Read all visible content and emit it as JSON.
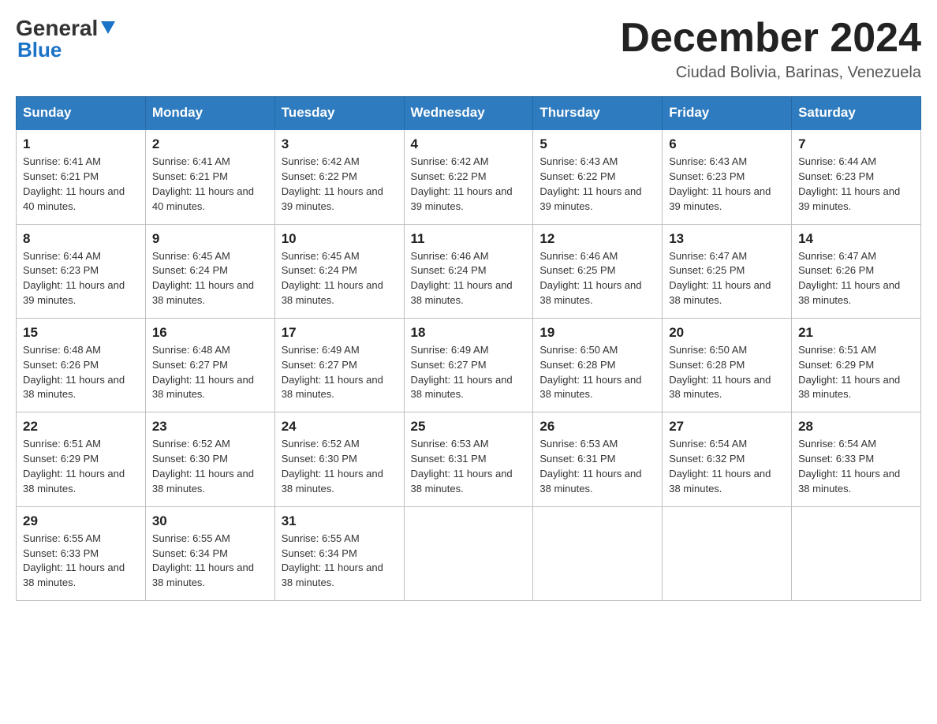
{
  "header": {
    "logo": {
      "general": "General",
      "blue": "Blue"
    },
    "title": "December 2024",
    "subtitle": "Ciudad Bolivia, Barinas, Venezuela"
  },
  "days_of_week": [
    "Sunday",
    "Monday",
    "Tuesday",
    "Wednesday",
    "Thursday",
    "Friday",
    "Saturday"
  ],
  "weeks": [
    {
      "days": [
        {
          "num": "1",
          "sunrise": "6:41 AM",
          "sunset": "6:21 PM",
          "daylight": "11 hours and 40 minutes."
        },
        {
          "num": "2",
          "sunrise": "6:41 AM",
          "sunset": "6:21 PM",
          "daylight": "11 hours and 40 minutes."
        },
        {
          "num": "3",
          "sunrise": "6:42 AM",
          "sunset": "6:22 PM",
          "daylight": "11 hours and 39 minutes."
        },
        {
          "num": "4",
          "sunrise": "6:42 AM",
          "sunset": "6:22 PM",
          "daylight": "11 hours and 39 minutes."
        },
        {
          "num": "5",
          "sunrise": "6:43 AM",
          "sunset": "6:22 PM",
          "daylight": "11 hours and 39 minutes."
        },
        {
          "num": "6",
          "sunrise": "6:43 AM",
          "sunset": "6:23 PM",
          "daylight": "11 hours and 39 minutes."
        },
        {
          "num": "7",
          "sunrise": "6:44 AM",
          "sunset": "6:23 PM",
          "daylight": "11 hours and 39 minutes."
        }
      ]
    },
    {
      "days": [
        {
          "num": "8",
          "sunrise": "6:44 AM",
          "sunset": "6:23 PM",
          "daylight": "11 hours and 39 minutes."
        },
        {
          "num": "9",
          "sunrise": "6:45 AM",
          "sunset": "6:24 PM",
          "daylight": "11 hours and 38 minutes."
        },
        {
          "num": "10",
          "sunrise": "6:45 AM",
          "sunset": "6:24 PM",
          "daylight": "11 hours and 38 minutes."
        },
        {
          "num": "11",
          "sunrise": "6:46 AM",
          "sunset": "6:24 PM",
          "daylight": "11 hours and 38 minutes."
        },
        {
          "num": "12",
          "sunrise": "6:46 AM",
          "sunset": "6:25 PM",
          "daylight": "11 hours and 38 minutes."
        },
        {
          "num": "13",
          "sunrise": "6:47 AM",
          "sunset": "6:25 PM",
          "daylight": "11 hours and 38 minutes."
        },
        {
          "num": "14",
          "sunrise": "6:47 AM",
          "sunset": "6:26 PM",
          "daylight": "11 hours and 38 minutes."
        }
      ]
    },
    {
      "days": [
        {
          "num": "15",
          "sunrise": "6:48 AM",
          "sunset": "6:26 PM",
          "daylight": "11 hours and 38 minutes."
        },
        {
          "num": "16",
          "sunrise": "6:48 AM",
          "sunset": "6:27 PM",
          "daylight": "11 hours and 38 minutes."
        },
        {
          "num": "17",
          "sunrise": "6:49 AM",
          "sunset": "6:27 PM",
          "daylight": "11 hours and 38 minutes."
        },
        {
          "num": "18",
          "sunrise": "6:49 AM",
          "sunset": "6:27 PM",
          "daylight": "11 hours and 38 minutes."
        },
        {
          "num": "19",
          "sunrise": "6:50 AM",
          "sunset": "6:28 PM",
          "daylight": "11 hours and 38 minutes."
        },
        {
          "num": "20",
          "sunrise": "6:50 AM",
          "sunset": "6:28 PM",
          "daylight": "11 hours and 38 minutes."
        },
        {
          "num": "21",
          "sunrise": "6:51 AM",
          "sunset": "6:29 PM",
          "daylight": "11 hours and 38 minutes."
        }
      ]
    },
    {
      "days": [
        {
          "num": "22",
          "sunrise": "6:51 AM",
          "sunset": "6:29 PM",
          "daylight": "11 hours and 38 minutes."
        },
        {
          "num": "23",
          "sunrise": "6:52 AM",
          "sunset": "6:30 PM",
          "daylight": "11 hours and 38 minutes."
        },
        {
          "num": "24",
          "sunrise": "6:52 AM",
          "sunset": "6:30 PM",
          "daylight": "11 hours and 38 minutes."
        },
        {
          "num": "25",
          "sunrise": "6:53 AM",
          "sunset": "6:31 PM",
          "daylight": "11 hours and 38 minutes."
        },
        {
          "num": "26",
          "sunrise": "6:53 AM",
          "sunset": "6:31 PM",
          "daylight": "11 hours and 38 minutes."
        },
        {
          "num": "27",
          "sunrise": "6:54 AM",
          "sunset": "6:32 PM",
          "daylight": "11 hours and 38 minutes."
        },
        {
          "num": "28",
          "sunrise": "6:54 AM",
          "sunset": "6:33 PM",
          "daylight": "11 hours and 38 minutes."
        }
      ]
    },
    {
      "days": [
        {
          "num": "29",
          "sunrise": "6:55 AM",
          "sunset": "6:33 PM",
          "daylight": "11 hours and 38 minutes."
        },
        {
          "num": "30",
          "sunrise": "6:55 AM",
          "sunset": "6:34 PM",
          "daylight": "11 hours and 38 minutes."
        },
        {
          "num": "31",
          "sunrise": "6:55 AM",
          "sunset": "6:34 PM",
          "daylight": "11 hours and 38 minutes."
        },
        null,
        null,
        null,
        null
      ]
    }
  ],
  "colors": {
    "header_bg": "#2e7bbf",
    "header_text": "#ffffff",
    "border": "#c0c0c0",
    "logo_blue": "#1a73c7"
  }
}
